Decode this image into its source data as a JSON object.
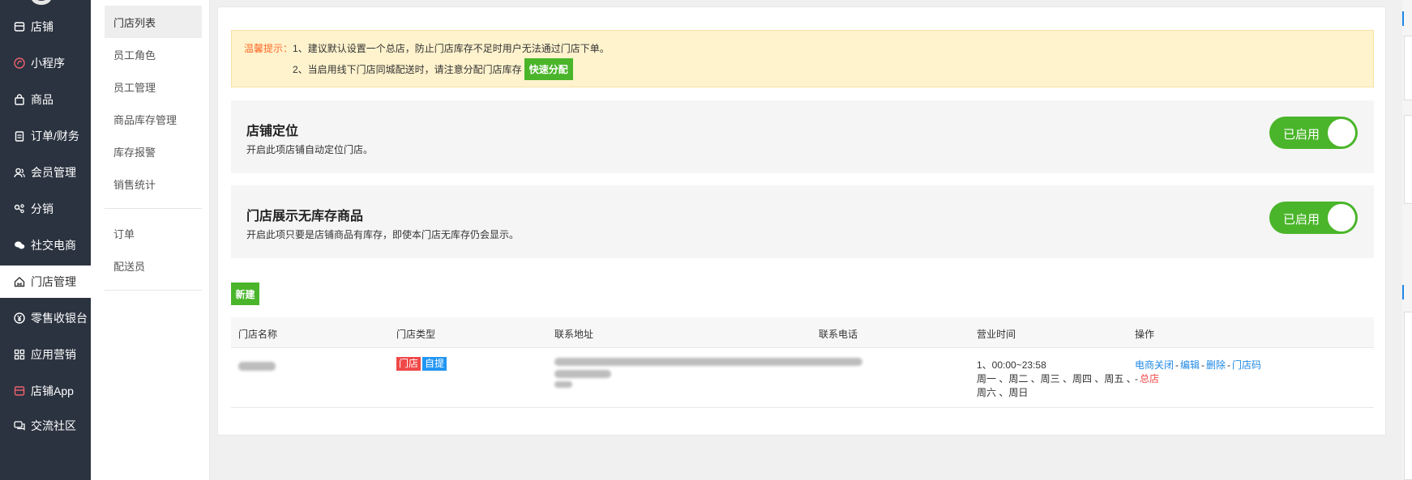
{
  "sidebar": {
    "items": [
      {
        "label": "店铺",
        "icon": "store-icon"
      },
      {
        "label": "小程序",
        "icon": "miniprogram-icon"
      },
      {
        "label": "商品",
        "icon": "bag-icon"
      },
      {
        "label": "订单/财务",
        "icon": "clipboard-icon"
      },
      {
        "label": "会员管理",
        "icon": "users-icon"
      },
      {
        "label": "分销",
        "icon": "share-icon"
      },
      {
        "label": "社交电商",
        "icon": "chat-icon"
      },
      {
        "label": "门店管理",
        "icon": "home-icon",
        "active": true
      },
      {
        "label": "零售收银台",
        "icon": "yen-icon"
      },
      {
        "label": "应用营销",
        "icon": "apps-icon"
      },
      {
        "label": "店铺App",
        "icon": "app-icon"
      },
      {
        "label": "交流社区",
        "icon": "community-icon"
      }
    ]
  },
  "submenu": {
    "group1": [
      "门店列表",
      "员工角色",
      "员工管理",
      "商品库存管理",
      "库存报警",
      "销售统计"
    ],
    "group2": [
      "订单",
      "配送员"
    ]
  },
  "tip": {
    "prefix": "温馨提示：",
    "line1": "1、建议默认设置一个总店，防止门店库存不足时用户无法通过门店下单。",
    "line2": "2、当启用线下门店同城配送时，请注意分配门店库存",
    "button": "快速分配"
  },
  "settings": [
    {
      "title": "店铺定位",
      "desc": "开启此项店铺自动定位门店。",
      "toggle": "已启用",
      "enabled": true
    },
    {
      "title": "门店展示无库存商品",
      "desc": "开启此项只要是店铺商品有库存，即使本门店无库存仍会显示。",
      "toggle": "已启用",
      "enabled": true
    }
  ],
  "new_button": "新建",
  "table": {
    "headers": [
      "门店名称",
      "门店类型",
      "联系地址",
      "联系电话",
      "营业时间",
      "操作"
    ],
    "rows": [
      {
        "tags": [
          "门店",
          "自提"
        ],
        "hours_line1": "1、00:00~23:58",
        "hours_line2": "周一 、周二 、周三 、周四 、周五 、",
        "hours_line3": "周六 、周日",
        "ops": [
          "电商关闭",
          "编辑",
          "删除",
          "门店码",
          "总店"
        ]
      }
    ]
  },
  "colors": {
    "sidebar_bg": "#2b3340",
    "accent_green": "#4ab52a",
    "link_blue": "#1e88e5",
    "tag_red": "#f04848",
    "tip_bg": "#fff3cd"
  }
}
